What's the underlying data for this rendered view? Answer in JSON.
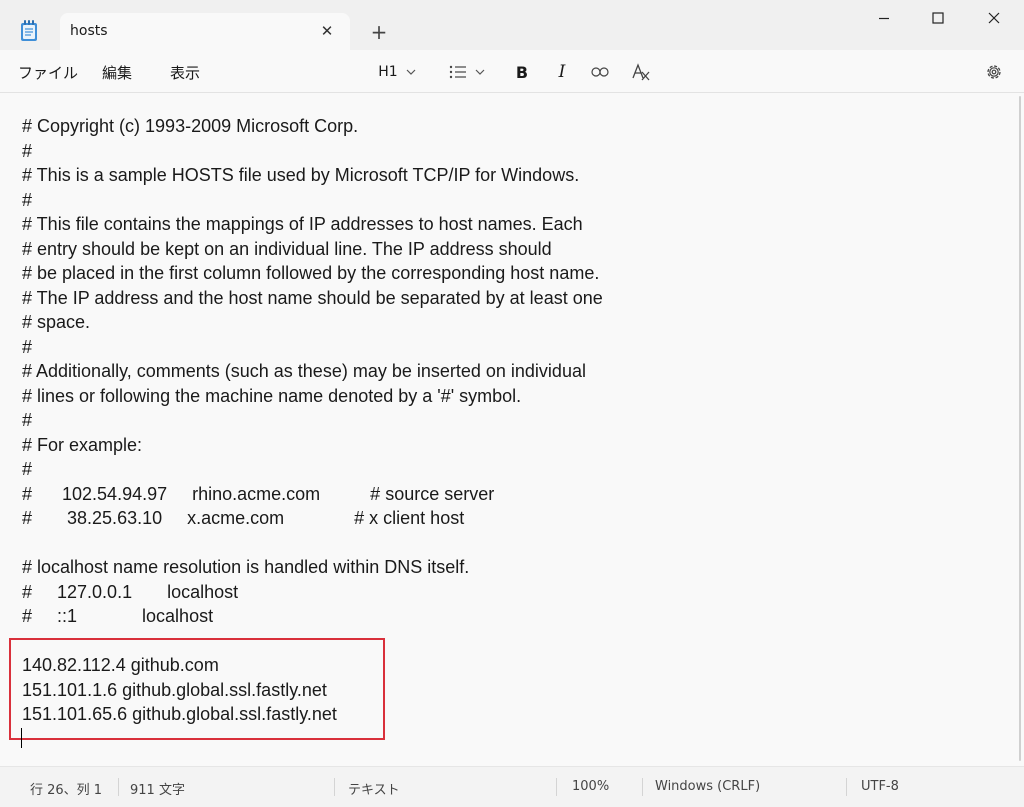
{
  "window": {
    "tab_title": "hosts",
    "new_tab": "+",
    "close_tab": "✕"
  },
  "menu": {
    "file": "ファイル",
    "edit": "編集",
    "view": "表示"
  },
  "toolbar": {
    "heading": "H1",
    "list_icon": "list-icon",
    "bold": "B",
    "italic": "I"
  },
  "editor": {
    "lines": [
      "# Copyright (c) 1993-2009 Microsoft Corp.",
      "#",
      "# This is a sample HOSTS file used by Microsoft TCP/IP for Windows.",
      "#",
      "# This file contains the mappings of IP addresses to host names. Each",
      "# entry should be kept on an individual line. The IP address should",
      "# be placed in the first column followed by the corresponding host name.",
      "# The IP address and the host name should be separated by at least one",
      "# space.",
      "#",
      "# Additionally, comments (such as these) may be inserted on individual",
      "# lines or following the machine name denoted by a '#' symbol.",
      "#",
      "# For example:",
      "#",
      "#      102.54.94.97     rhino.acme.com          # source server",
      "#       38.25.63.10     x.acme.com              # x client host",
      "",
      "# localhost name resolution is handled within DNS itself.",
      "#     127.0.0.1       localhost",
      "#     ::1             localhost",
      "",
      "140.82.112.4 github.com",
      "151.101.1.6 github.global.ssl.fastly.net",
      "151.101.65.6 github.global.ssl.fastly.net",
      ""
    ]
  },
  "status": {
    "position": "行 26、列 1",
    "chars": "911 文字",
    "format": "テキスト",
    "zoom": "100%",
    "line_ending": "Windows (CRLF)",
    "encoding": "UTF-8"
  },
  "colors": {
    "highlight_border": "#d9303b"
  }
}
